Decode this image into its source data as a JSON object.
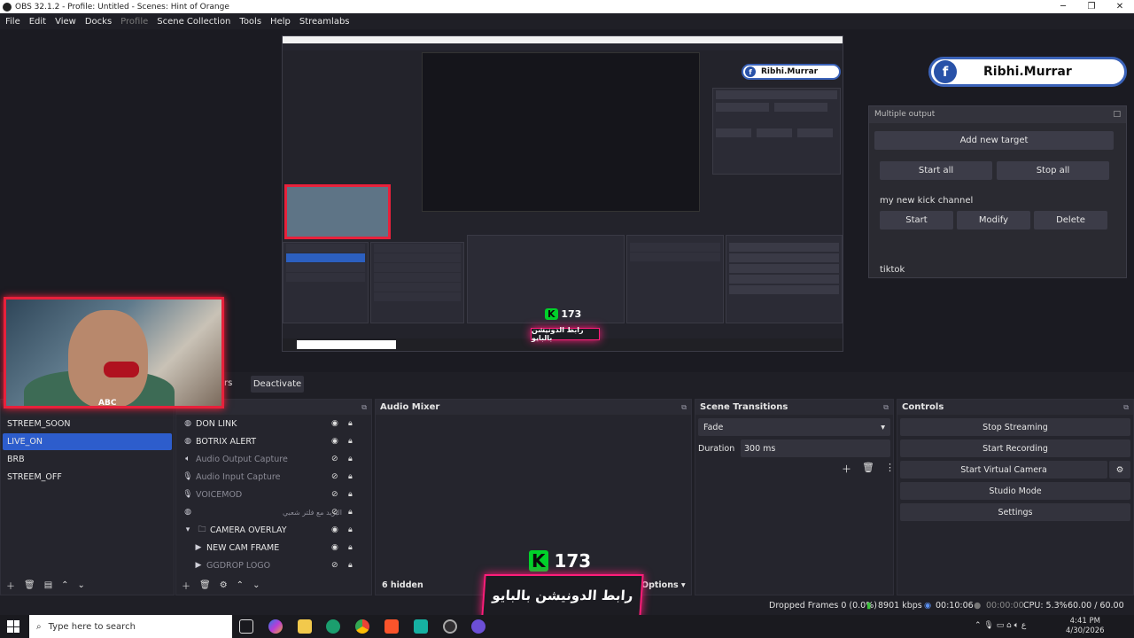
{
  "window": {
    "title": "OBS 32.1.2 - Profile: Untitled - Scenes: Hint of Orange",
    "minimize": "─",
    "maximize": "❐",
    "close": "✕"
  },
  "menu": [
    "File",
    "Edit",
    "View",
    "Docks",
    "Profile",
    "Scene Collection",
    "Tools",
    "Help",
    "Streamlabs"
  ],
  "overlay": {
    "facebook_name": "Ribhi.Murrar",
    "kick_count": "173",
    "kick_letter": "K",
    "arabic_text": "رابط الدونيشن بالبايو",
    "webcam_tag": "ABC"
  },
  "multiple_output": {
    "title": "Multiple output",
    "add_new_target": "Add new target",
    "start_all": "Start all",
    "stop_all": "Stop all",
    "channel_name": "my new kick channel",
    "start": "Start",
    "modify": "Modify",
    "delete": "Delete",
    "tiktok": "tiktok"
  },
  "preview_toolbar": {
    "filters_partial": "rs",
    "deactivate": "Deactivate"
  },
  "scenes": {
    "items": [
      "STREEM_SOON",
      "LIVE_ON",
      "BRB",
      "STREEM_OFF"
    ],
    "selected": "LIVE_ON"
  },
  "sources": {
    "items": [
      {
        "label": "DON LINK",
        "icon": "globe-icon",
        "dim": false
      },
      {
        "label": "BOTRIX ALERT",
        "icon": "globe-icon",
        "dim": false
      },
      {
        "label": "Audio Output Capture",
        "icon": "speaker-icon",
        "dim": true
      },
      {
        "label": "Audio Input Capture",
        "icon": "mic-icon",
        "dim": true
      },
      {
        "label": "VOICEMOD",
        "icon": "mic-icon",
        "dim": true
      },
      {
        "label": "البريد مع فلتر شعبي",
        "icon": "globe-icon",
        "dim": true
      },
      {
        "label": "CAMERA OVERLAY",
        "icon": "folder-icon",
        "dim": false
      },
      {
        "label": "NEW CAM FRAME",
        "icon": "play-icon",
        "dim": false
      },
      {
        "label": "GGDROP LOGO",
        "icon": "play-icon",
        "dim": true
      }
    ]
  },
  "audio_mixer": {
    "title": "Audio Mixer",
    "hidden": "6 hidden",
    "options": "Options"
  },
  "scene_transitions": {
    "title": "Scene Transitions",
    "transition": "Fade",
    "duration_label": "Duration",
    "duration_value": "300 ms"
  },
  "controls": {
    "title": "Controls",
    "stop_streaming": "Stop Streaming",
    "start_recording": "Start Recording",
    "start_virtual_camera": "Start Virtual Camera",
    "studio_mode": "Studio Mode",
    "settings": "Settings"
  },
  "status": {
    "dropped_frames": "Dropped Frames 0 (0.0%)",
    "bitrate": "8901 kbps",
    "stream_time": "00:10:06",
    "rec_time": "00:00:00",
    "cpu": "CPU: 5.3%",
    "fps": "60.00 / 60.00"
  },
  "taskbar": {
    "search_placeholder": "Type here to search",
    "time": "4:41 PM",
    "date": "4/30/2026"
  },
  "colors": {
    "accent": "#2d5dcc",
    "webcam_border": "#e8213b",
    "kick_green": "#00d12a",
    "banner_pink": "#ff1d7a",
    "facebook_blue": "#2952a8"
  }
}
